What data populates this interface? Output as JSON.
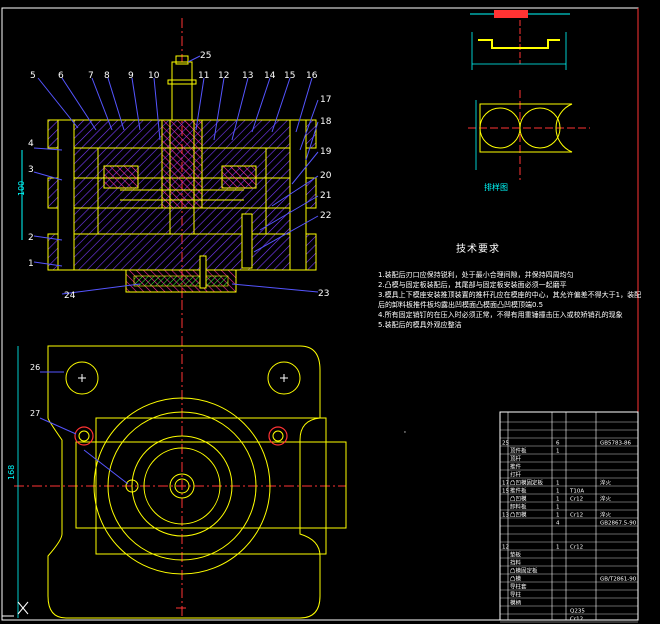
{
  "colors": {
    "background": "#000000",
    "outline": "#ffff00",
    "centerline": "#ff3333",
    "dimension": "#00ffff",
    "hatch": "#ff00ff",
    "leader": "#5555ff",
    "border": "#ffffff",
    "part_green": "#33ff33"
  },
  "top_right_view": {
    "caption": "排样图"
  },
  "section_view": {
    "left_label": "100",
    "bottom_left_label": "24",
    "bottom_right_label": "23",
    "top_labels": [
      "5",
      "6",
      "7",
      "8",
      "9",
      "10",
      "11",
      "12",
      "13",
      "14",
      "15",
      "16"
    ],
    "left_side_labels": [
      "4",
      "3",
      "2",
      "1"
    ],
    "right_side_labels": [
      "17",
      "18",
      "19",
      "20",
      "21",
      "22"
    ],
    "top_pin_label": "25"
  },
  "plan_view": {
    "top_left_label": "26",
    "left_label": "27",
    "side_dimension": "168"
  },
  "technical_requirements": {
    "title": "技术要求",
    "items": [
      "1.装配后刃口应保持锐利，处于最小合理间隙，并保持四周均匀",
      "2.凸模与固定板装配后，其尾部与固定板安装面必须一起磨平",
      "3.模具上下模座安装推顶装置的推杆孔应在模座的中心，其允许偏差不得大于1，装配后的卸料板推件板均露出凹模面凸模面凸凹模顶端0.5",
      "4.所有固定销钉的在压入时必须正常，不得有用重锤撞击压入或校矫销孔的现象",
      "5.装配后的模具外观应整洁"
    ]
  },
  "parts_table": {
    "rows": [
      {
        "no": "",
        "name": "",
        "qty": "",
        "mat": "",
        "std": ""
      },
      {
        "no": "",
        "name": "",
        "qty": "",
        "mat": "",
        "std": ""
      },
      {
        "no": "",
        "name": "",
        "qty": "",
        "mat": "",
        "std": ""
      },
      {
        "no": "25",
        "name": "",
        "qty": "6",
        "mat": "",
        "std": "GB5783-86"
      },
      {
        "no": "",
        "name": "顶件板",
        "qty": "1",
        "mat": "",
        "std": ""
      },
      {
        "no": "",
        "name": "顶杆",
        "qty": "",
        "mat": "",
        "std": ""
      },
      {
        "no": "",
        "name": "推件",
        "qty": "",
        "mat": "",
        "std": ""
      },
      {
        "no": "",
        "name": "打杆",
        "qty": "",
        "mat": "",
        "std": ""
      },
      {
        "no": "17",
        "name": "凸凹模固定板",
        "qty": "1",
        "mat": "",
        "std": "淬火"
      },
      {
        "no": "15",
        "name": "推件板",
        "qty": "1",
        "mat": "T10A",
        "std": ""
      },
      {
        "no": "",
        "name": "凸凹模",
        "qty": "1",
        "mat": "Cr12",
        "std": "淬火"
      },
      {
        "no": "",
        "name": "卸料板",
        "qty": "1",
        "mat": "",
        "std": ""
      },
      {
        "no": "13",
        "name": "凸凹模",
        "qty": "1",
        "mat": "Cr12",
        "std": "淬火"
      },
      {
        "no": "",
        "name": "",
        "qty": "4",
        "mat": "",
        "std": "GB2867.5-90"
      },
      {
        "no": "",
        "name": "",
        "qty": "",
        "mat": "",
        "std": ""
      },
      {
        "no": "",
        "name": "",
        "qty": "",
        "mat": "",
        "std": ""
      },
      {
        "no": "12",
        "name": "",
        "qty": "1",
        "mat": "Cr12",
        "std": ""
      },
      {
        "no": "",
        "name": "垫板",
        "qty": "",
        "mat": "",
        "std": ""
      },
      {
        "no": "",
        "name": "挡料",
        "qty": "",
        "mat": "",
        "std": ""
      },
      {
        "no": "",
        "name": "凸模固定板",
        "qty": "",
        "mat": "",
        "std": ""
      },
      {
        "no": "",
        "name": "凸模",
        "qty": "",
        "mat": "",
        "std": "GB/T2861-90"
      },
      {
        "no": "",
        "name": "导柱套",
        "qty": "",
        "mat": "",
        "std": ""
      },
      {
        "no": "",
        "name": "导柱",
        "qty": "",
        "mat": "",
        "std": ""
      },
      {
        "no": "",
        "name": "模柄",
        "qty": "",
        "mat": "",
        "std": ""
      },
      {
        "no": "",
        "name": "",
        "qty": "",
        "mat": "Q235",
        "std": ""
      },
      {
        "no": "",
        "name": "",
        "qty": "",
        "mat": "Cr12",
        "std": ""
      }
    ]
  }
}
